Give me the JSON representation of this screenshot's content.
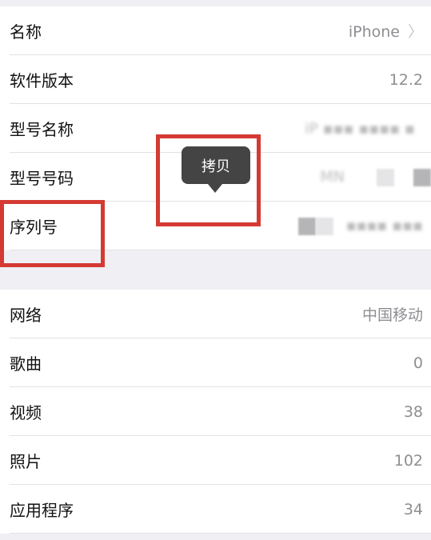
{
  "about": {
    "group1": [
      {
        "label": "名称",
        "value": "iPhone",
        "chevron": true
      },
      {
        "label": "软件版本",
        "value": "12.2"
      },
      {
        "label": "型号名称",
        "value": "iP"
      },
      {
        "label": "型号号码",
        "value": "MN"
      },
      {
        "label": "序列号",
        "value": ""
      }
    ],
    "group2": [
      {
        "label": "网络",
        "value": "中国移动"
      },
      {
        "label": "歌曲",
        "value": "0"
      },
      {
        "label": "视频",
        "value": "38"
      },
      {
        "label": "照片",
        "value": "102"
      },
      {
        "label": "应用程序",
        "value": "34"
      }
    ]
  },
  "tooltip": {
    "label": "拷贝"
  },
  "colors": {
    "highlight": "#d43a33",
    "tooltip_bg": "#444444"
  }
}
